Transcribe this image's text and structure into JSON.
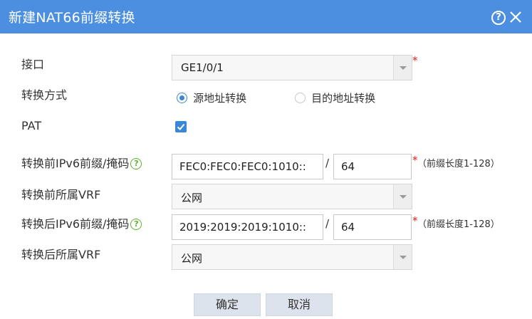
{
  "dialog": {
    "title": "新建NAT66前缀转换",
    "help_icon_glyph": "?",
    "accent_color": "#4c8fe0"
  },
  "form": {
    "interface": {
      "label": "接口",
      "value": "GE1/0/1",
      "required_mark": "*"
    },
    "mode": {
      "label": "转换方式",
      "options": [
        {
          "label": "源地址转换",
          "selected": true
        },
        {
          "label": "目的地址转换",
          "selected": false
        }
      ]
    },
    "pat": {
      "label": "PAT",
      "checked": true
    },
    "pre_prefix": {
      "label": "转换前IPv6前缀/掩码",
      "help_glyph": "?",
      "address": "FEC0:FEC0:FEC0:1010::",
      "separator": "/",
      "mask": "64",
      "required_mark": "*",
      "hint": "（前缀长度1-128）"
    },
    "pre_vrf": {
      "label": "转换前所属VRF",
      "value": "公网"
    },
    "post_prefix": {
      "label": "转换后IPv6前缀/掩码",
      "help_glyph": "?",
      "address": "2019:2019:2019:1010::",
      "separator": "/",
      "mask": "64",
      "required_mark": "*",
      "hint": "（前缀长度1-128）"
    },
    "post_vrf": {
      "label": "转换后所属VRF",
      "value": "公网"
    }
  },
  "buttons": {
    "ok": "确定",
    "cancel": "取消"
  }
}
